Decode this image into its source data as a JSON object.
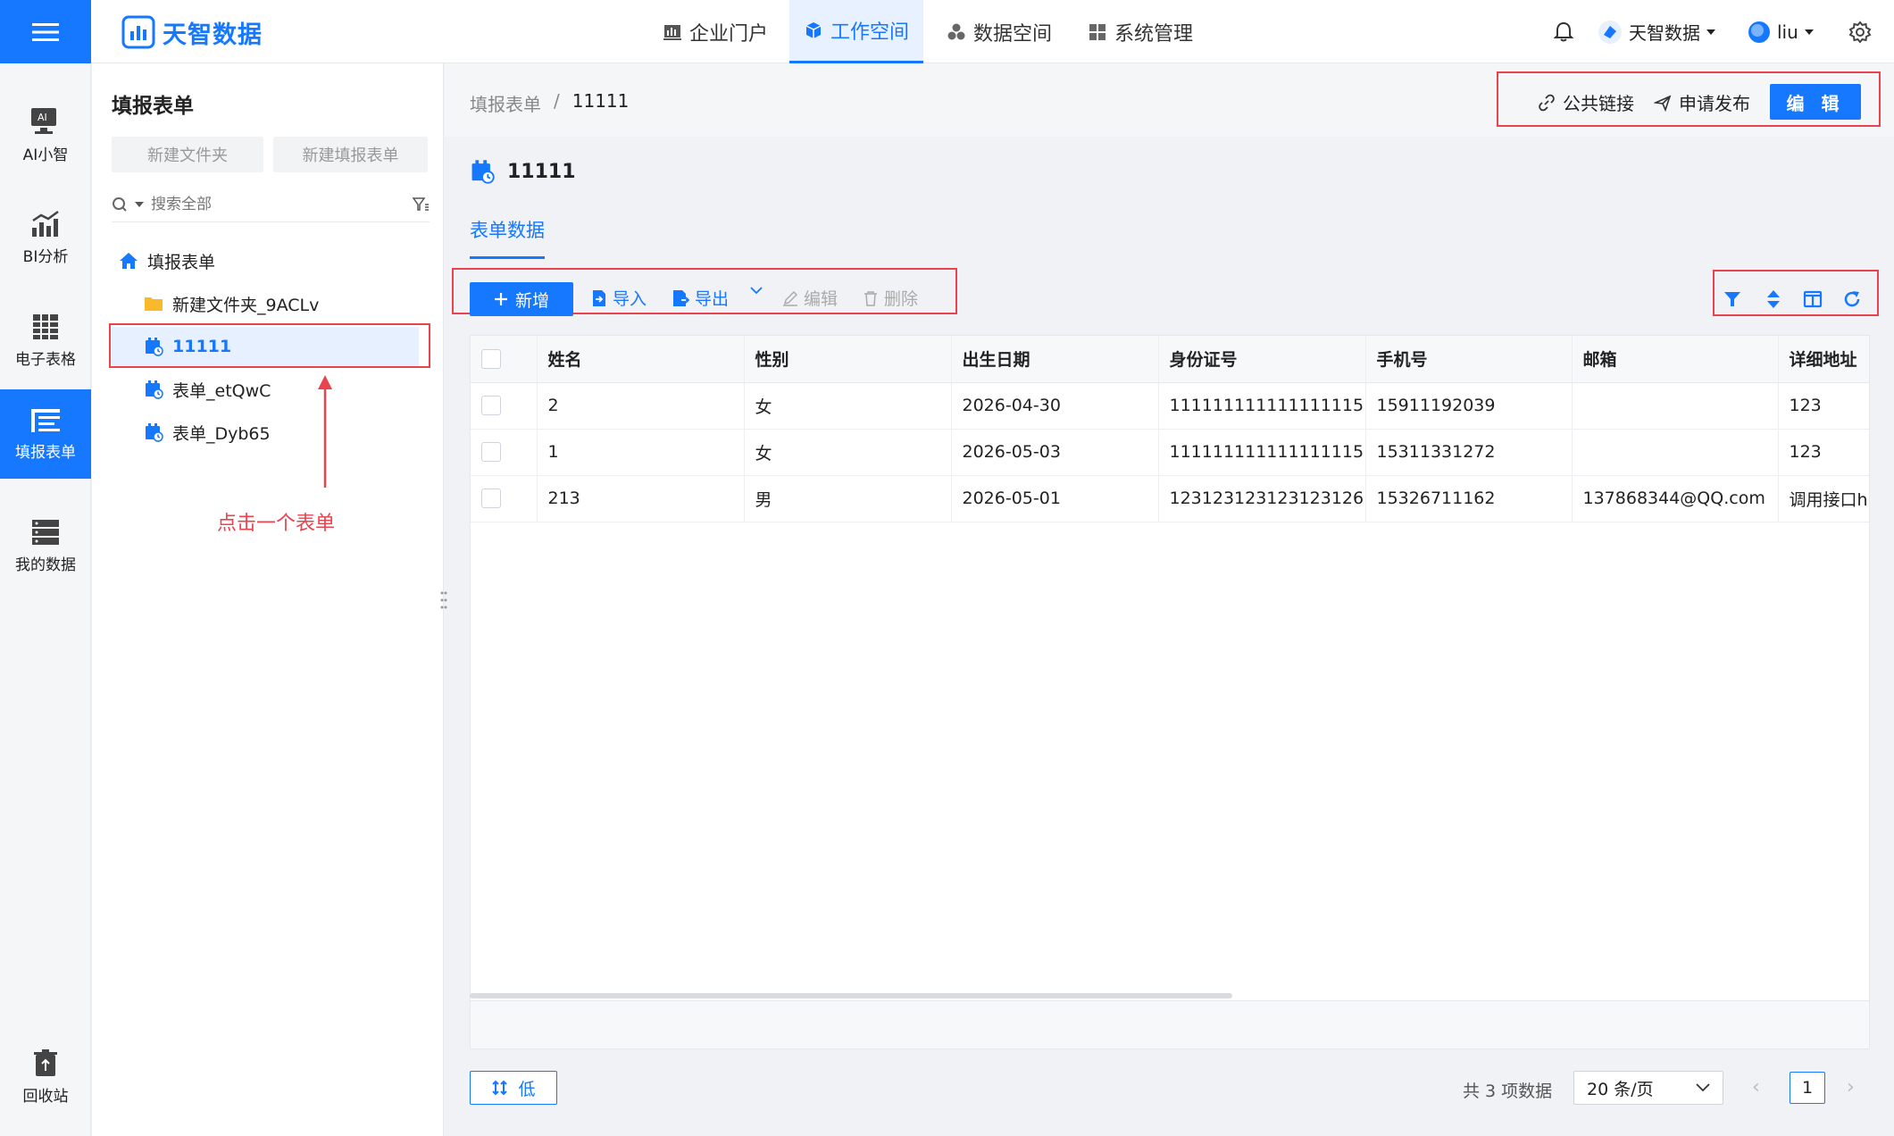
{
  "app": {
    "logo_text": "天智数据"
  },
  "topnav": [
    {
      "label": "企业门户",
      "icon": "portal-icon"
    },
    {
      "label": "工作空间",
      "icon": "cube-icon",
      "active": true
    },
    {
      "label": "数据空间",
      "icon": "data-space-icon"
    },
    {
      "label": "系统管理",
      "icon": "grid-icon"
    }
  ],
  "toptools": {
    "org": "天智数据",
    "user": "liu"
  },
  "rail": [
    {
      "label": "AI小智",
      "icon": "ai-icon"
    },
    {
      "label": "BI分析",
      "icon": "chart-icon"
    },
    {
      "label": "电子表格",
      "icon": "spreadsheet-icon"
    },
    {
      "label": "填报表单",
      "icon": "form-list-icon",
      "active": true
    },
    {
      "label": "我的数据",
      "icon": "database-icon"
    },
    {
      "label": "回收站",
      "icon": "recycle-icon"
    }
  ],
  "tree": {
    "title": "填报表单",
    "new_folder": "新建文件夹",
    "new_form": "新建填报表单",
    "search_placeholder": "搜索全部",
    "root": "填报表单",
    "nodes": [
      "新建文件夹_9ACLv",
      "11111",
      "表单_etQwC",
      "表单_Dyb65"
    ]
  },
  "annotation": {
    "text": "点击一个表单"
  },
  "breadcrumb": {
    "parent": "填报表单",
    "sep": "/",
    "current": "11111"
  },
  "header_actions": {
    "public_link": "公共链接",
    "publish": "申请发布",
    "edit": "编 辑"
  },
  "form": {
    "title": "11111",
    "tab": "表单数据"
  },
  "toolbar": {
    "add": "新增",
    "import": "导入",
    "export": "导出",
    "edit": "编辑",
    "delete": "删除"
  },
  "table": {
    "columns": [
      "姓名",
      "性别",
      "出生日期",
      "身份证号",
      "手机号",
      "邮箱",
      "详细地址"
    ],
    "rows": [
      [
        "2",
        "女",
        "2026-04-30",
        "111111111111111115",
        "15911192039",
        "",
        "123"
      ],
      [
        "1",
        "女",
        "2026-05-03",
        "111111111111111115",
        "15311331272",
        "",
        "123"
      ],
      [
        "213",
        "男",
        "2026-05-01",
        "123123123123123126",
        "15326711162",
        "137868344@QQ.com",
        "调用接口h"
      ]
    ]
  },
  "footer": {
    "density": "低",
    "total": "共 3 项数据",
    "page_size": "20 条/页",
    "current_page": "1",
    "prev": "‹",
    "next": "›"
  },
  "colors": {
    "primary": "#1677ff",
    "annotation": "#e8434e"
  }
}
